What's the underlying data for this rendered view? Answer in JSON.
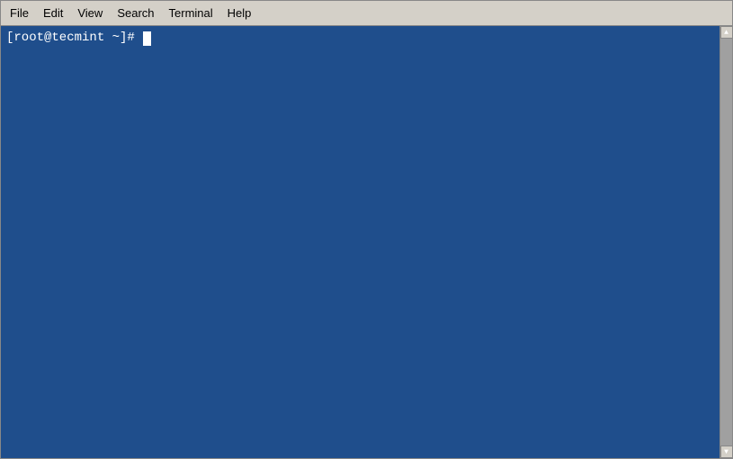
{
  "menubar": {
    "items": [
      {
        "label": "File",
        "id": "file"
      },
      {
        "label": "Edit",
        "id": "edit"
      },
      {
        "label": "View",
        "id": "view"
      },
      {
        "label": "Search",
        "id": "search"
      },
      {
        "label": "Terminal",
        "id": "terminal"
      },
      {
        "label": "Help",
        "id": "help"
      }
    ]
  },
  "terminal": {
    "prompt": "[root@tecmint ~]# ",
    "background_color": "#1f4e8c",
    "text_color": "#ffffff"
  }
}
